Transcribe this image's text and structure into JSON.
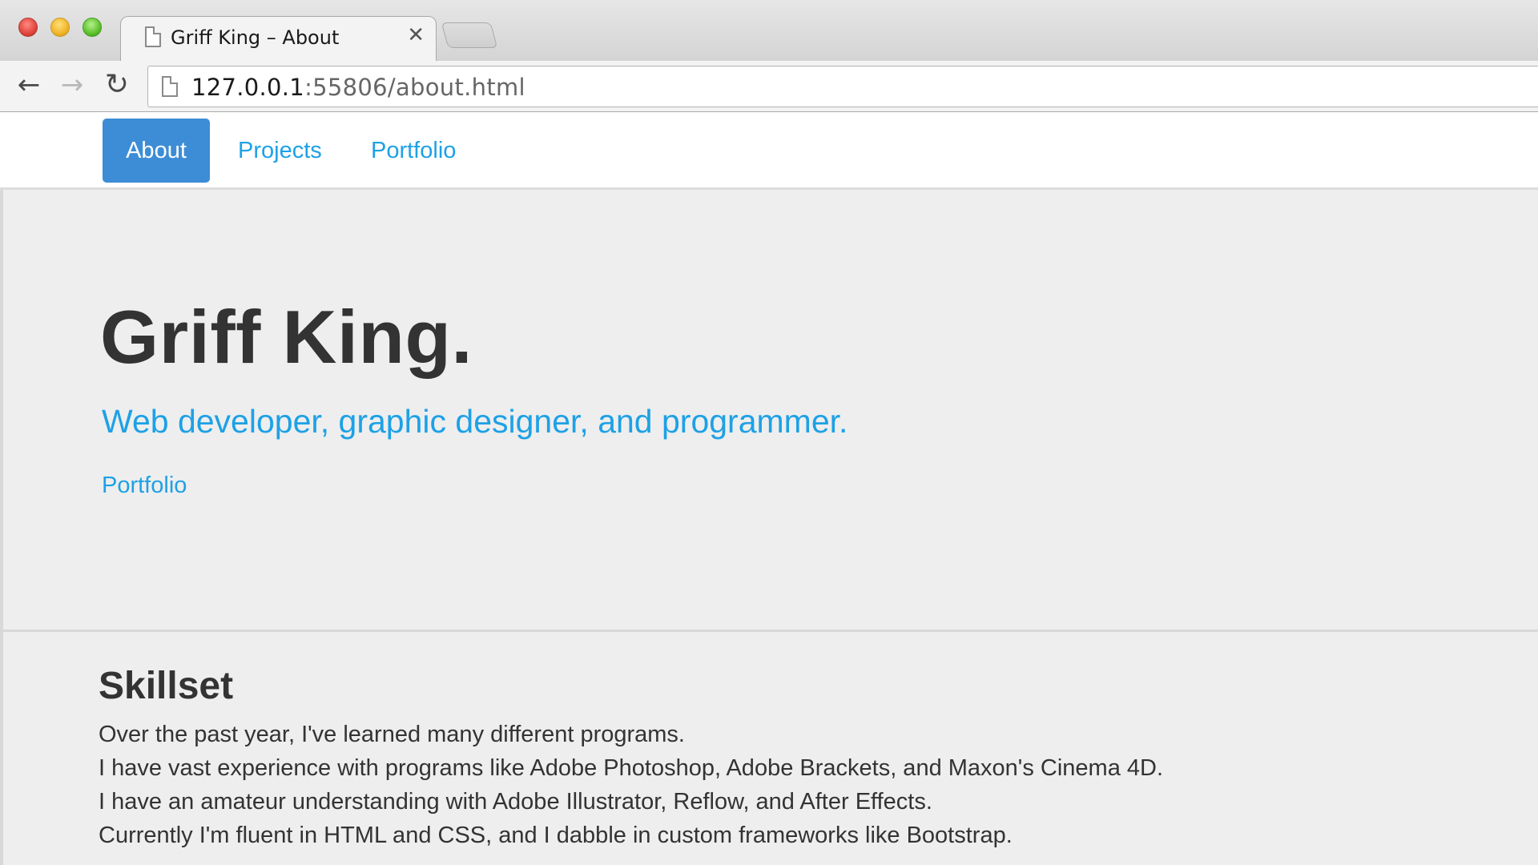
{
  "browser": {
    "tab": {
      "title": "Griff King – About",
      "close_glyph": "✕"
    },
    "toolbar": {
      "back_glyph": "←",
      "forward_glyph": "→",
      "reload_glyph": "↻",
      "url_host": "127.0.0.1",
      "url_rest": ":55806/about.html"
    }
  },
  "nav": {
    "items": [
      {
        "label": "About",
        "active": true
      },
      {
        "label": "Projects",
        "active": false
      },
      {
        "label": "Portfolio",
        "active": false
      }
    ]
  },
  "hero": {
    "title": "Griff King.",
    "subtitle": "Web developer, graphic designer, and programmer.",
    "link": "Portfolio"
  },
  "skills": {
    "title": "Skillset",
    "lines": [
      "Over the past year, I've learned many different programs.",
      "I have vast experience with programs like Adobe Photoshop, Adobe Brackets, and Maxon's Cinema 4D.",
      "I have an amateur understanding with Adobe Illustrator, Reflow, and After Effects.",
      "Currently I'm fluent in HTML and CSS, and I dabble in custom frameworks like Bootstrap."
    ]
  },
  "colors": {
    "accent": "#1da1e6",
    "active_pill": "#3c8dd6",
    "heading": "#333333",
    "panel_bg": "#eeeeee"
  }
}
